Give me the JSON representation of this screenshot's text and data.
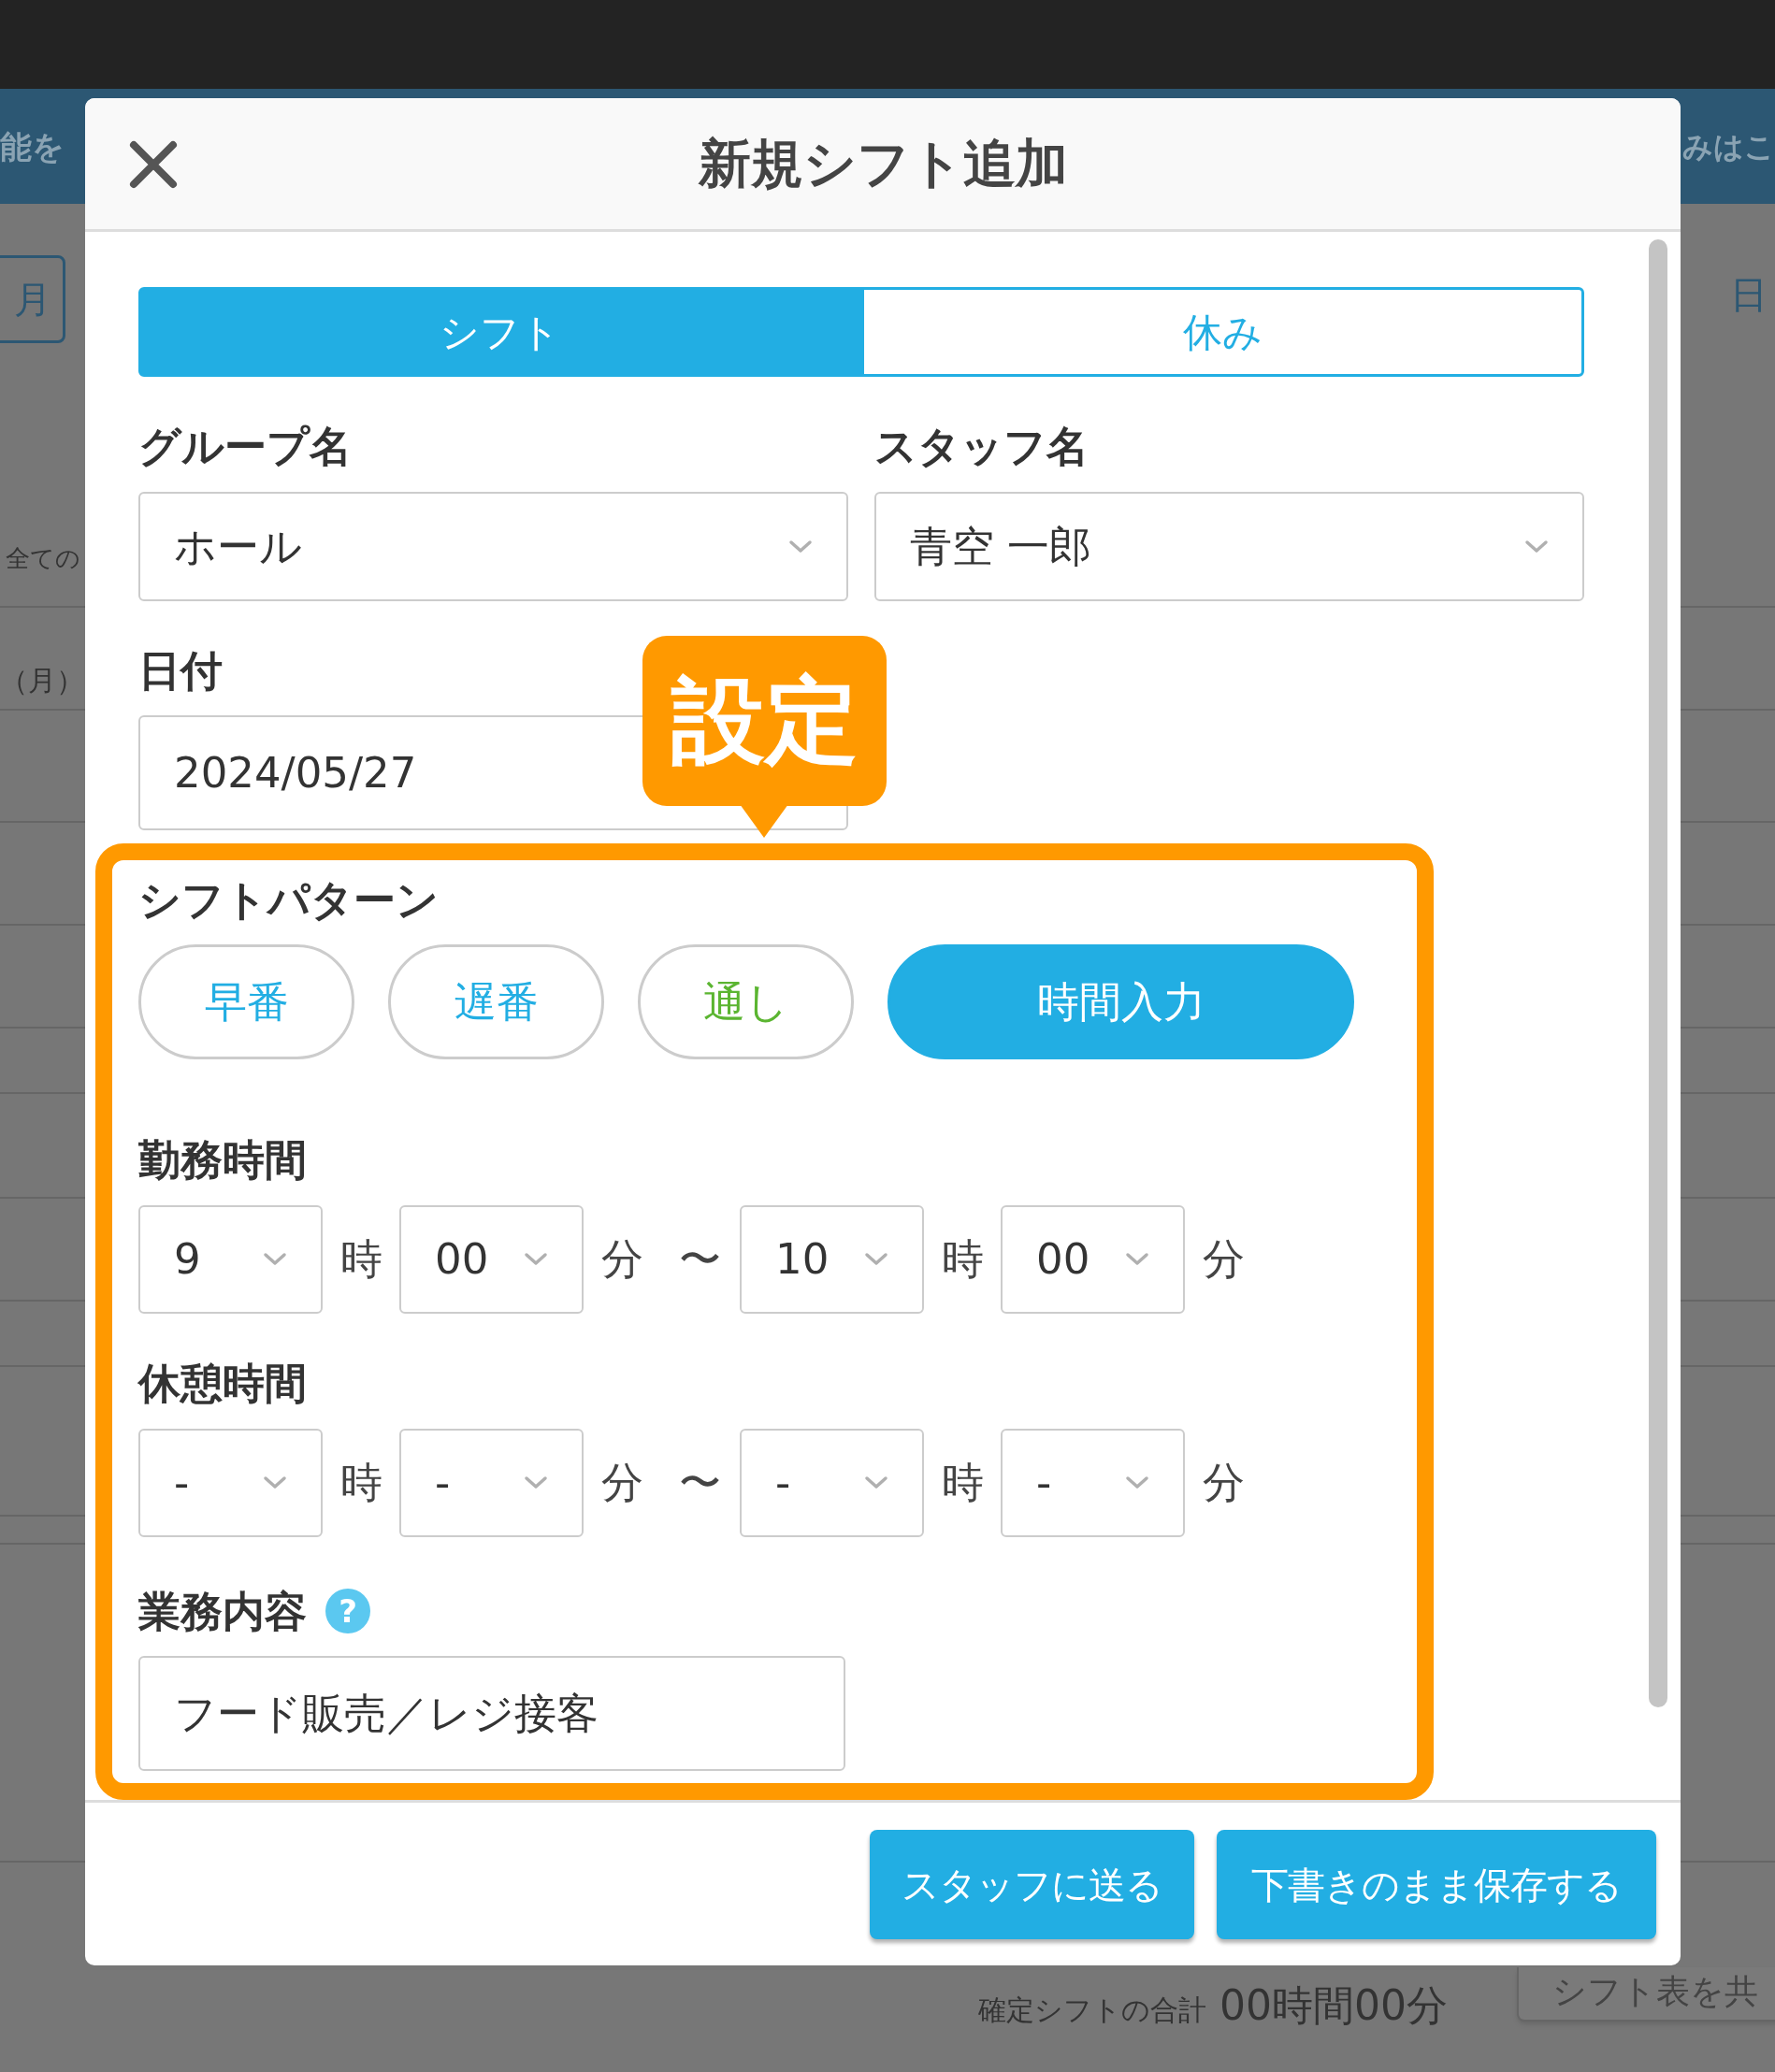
{
  "backdrop": {
    "header_left": "能を",
    "header_right": "みはこ",
    "left_button": "月",
    "right_label": "日",
    "filter_label": "全ての",
    "day_label": "（月）",
    "total_label": "確定シフトの合計",
    "total_value": "00時間00分",
    "share_button": "シフト表を共"
  },
  "dialog": {
    "title": "新規シフト追加",
    "tabs": [
      {
        "label": "シフト",
        "selected": true
      },
      {
        "label": "休み",
        "selected": false
      }
    ],
    "group": {
      "label": "グループ名",
      "value": "ホール"
    },
    "staff": {
      "label": "スタッフ名",
      "value": "青空 一郎"
    },
    "date": {
      "label": "日付",
      "value": "2024/05/27"
    },
    "callout": "設定",
    "pattern": {
      "label": "シフトパターン",
      "options": [
        {
          "label": "早番",
          "color": "#22aee3",
          "selected": false
        },
        {
          "label": "遅番",
          "color": "#22aee3",
          "selected": false
        },
        {
          "label": "通し",
          "color": "#5bb531",
          "selected": false
        },
        {
          "label": "時間入力",
          "color": "#22aee3",
          "selected": true
        }
      ]
    },
    "time_rows": [
      {
        "label": "勤務時間",
        "parts": [
          {
            "kind": "select",
            "value": "9"
          },
          {
            "kind": "unit",
            "text": "時"
          },
          {
            "kind": "select",
            "value": "00"
          },
          {
            "kind": "unit",
            "text": "分"
          },
          {
            "kind": "unit",
            "text": "〜"
          },
          {
            "kind": "select",
            "value": "10"
          },
          {
            "kind": "unit",
            "text": "時"
          },
          {
            "kind": "select",
            "value": "00"
          },
          {
            "kind": "unit",
            "text": "分"
          }
        ]
      },
      {
        "label": "休憩時間",
        "parts": [
          {
            "kind": "select",
            "value": "-"
          },
          {
            "kind": "unit",
            "text": "時"
          },
          {
            "kind": "select",
            "value": "-"
          },
          {
            "kind": "unit",
            "text": "分"
          },
          {
            "kind": "unit",
            "text": "〜"
          },
          {
            "kind": "select",
            "value": "-"
          },
          {
            "kind": "unit",
            "text": "時"
          },
          {
            "kind": "select",
            "value": "-"
          },
          {
            "kind": "unit",
            "text": "分"
          }
        ]
      }
    ],
    "tasks": {
      "label": "業務内容",
      "help": "?",
      "value": "フード販売／レジ接客"
    },
    "buttons": [
      "スタッフに送る",
      "下書きのまま保存する"
    ]
  }
}
